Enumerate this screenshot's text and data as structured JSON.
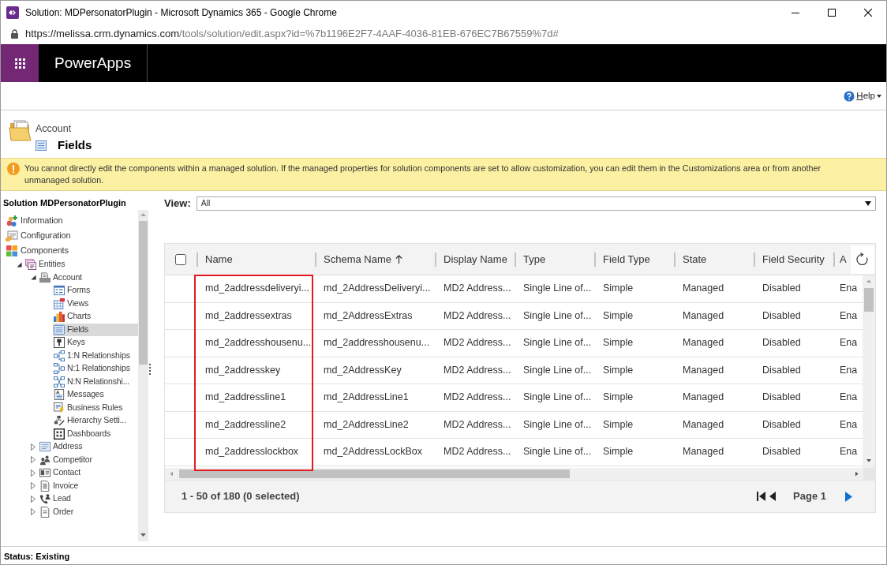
{
  "window": {
    "title": "Solution: MDPersonatorPlugin - Microsoft Dynamics 365 - Google Chrome"
  },
  "address_bar": {
    "host": "https://melissa.crm.dynamics.com",
    "path": "/tools/solution/edit.aspx?id=%7b1196E2F7-4AAF-4036-81EB-676EC7B67559%7d#"
  },
  "app_bar": {
    "title": "PowerApps"
  },
  "help": {
    "label": "Help"
  },
  "header": {
    "entity": "Account",
    "title": "Fields"
  },
  "notice": {
    "text": "You cannot directly edit the components within a managed solution. If the managed properties for solution components are set to allow customization, you can edit them in the Customizations area or from another unmanaged solution."
  },
  "sidebar": {
    "title": "Solution MDPersonatorPlugin",
    "items": [
      {
        "label": "Information",
        "kind": "information",
        "selected": false
      },
      {
        "label": "Configuration",
        "kind": "configuration",
        "selected": false
      },
      {
        "label": "Components",
        "kind": "components",
        "selected": false,
        "children": [
          {
            "label": "Entities",
            "kind": "entities",
            "selected": false,
            "expanded": true,
            "children": [
              {
                "label": "Account",
                "kind": "entity",
                "selected": false,
                "expanded": true,
                "children": [
                  {
                    "label": "Forms",
                    "kind": "forms",
                    "selected": false
                  },
                  {
                    "label": "Views",
                    "kind": "views",
                    "selected": false
                  },
                  {
                    "label": "Charts",
                    "kind": "charts",
                    "selected": false
                  },
                  {
                    "label": "Fields",
                    "kind": "fields",
                    "selected": true
                  },
                  {
                    "label": "Keys",
                    "kind": "keys",
                    "selected": false
                  },
                  {
                    "label": "1:N Relationships",
                    "kind": "relationship_1n",
                    "selected": false
                  },
                  {
                    "label": "N:1 Relationships",
                    "kind": "relationship_n1",
                    "selected": false
                  },
                  {
                    "label": "N:N Relationshi...",
                    "kind": "relationship_nn",
                    "selected": false
                  },
                  {
                    "label": "Messages",
                    "kind": "messages",
                    "selected": false
                  },
                  {
                    "label": "Business Rules",
                    "kind": "business_rules",
                    "selected": false
                  },
                  {
                    "label": "Hierarchy Setti...",
                    "kind": "hierarchy",
                    "selected": false
                  },
                  {
                    "label": "Dashboards",
                    "kind": "dashboards",
                    "selected": false
                  }
                ]
              },
              {
                "label": "Address",
                "kind": "address",
                "selected": false,
                "expanded": false
              },
              {
                "label": "Competitor",
                "kind": "competitor",
                "selected": false,
                "expanded": false
              },
              {
                "label": "Contact",
                "kind": "contact",
                "selected": false,
                "expanded": false
              },
              {
                "label": "Invoice",
                "kind": "invoice",
                "selected": false,
                "expanded": false
              },
              {
                "label": "Lead",
                "kind": "lead",
                "selected": false,
                "expanded": false
              },
              {
                "label": "Order",
                "kind": "order",
                "selected": false,
                "expanded": false
              }
            ]
          }
        ]
      }
    ]
  },
  "view": {
    "label": "View:",
    "value": "All"
  },
  "table": {
    "select_all": {
      "checked": false
    },
    "columns": [
      {
        "label": "Name",
        "highlighted": true,
        "sorted": false
      },
      {
        "label": "Schema Name",
        "highlighted": false,
        "sorted": true
      },
      {
        "label": "Display Name",
        "highlighted": false,
        "sorted": false
      },
      {
        "label": "Type",
        "highlighted": false,
        "sorted": false
      },
      {
        "label": "Field Type",
        "highlighted": false,
        "sorted": false
      },
      {
        "label": "State",
        "highlighted": false,
        "sorted": false
      },
      {
        "label": "Field Security",
        "highlighted": false,
        "sorted": false
      },
      {
        "label": "A",
        "highlighted": false,
        "sorted": false
      }
    ],
    "rows": [
      {
        "selected": false,
        "cells": [
          "md_2addressdeliveryi...",
          "md_2AddressDeliveryi...",
          "MD2 Address...",
          "Single Line of...",
          "Simple",
          "Managed",
          "Disabled",
          "Ena"
        ]
      },
      {
        "selected": false,
        "cells": [
          "md_2addressextras",
          "md_2AddressExtras",
          "MD2 Address...",
          "Single Line of...",
          "Simple",
          "Managed",
          "Disabled",
          "Ena"
        ]
      },
      {
        "selected": false,
        "cells": [
          "md_2addresshousenu...",
          "md_2addresshousenu...",
          "MD2 Address...",
          "Single Line of...",
          "Simple",
          "Managed",
          "Disabled",
          "Ena"
        ]
      },
      {
        "selected": false,
        "cells": [
          "md_2addresskey",
          "md_2AddressKey",
          "MD2 Address...",
          "Single Line of...",
          "Simple",
          "Managed",
          "Disabled",
          "Ena"
        ]
      },
      {
        "selected": false,
        "cells": [
          "md_2addressline1",
          "md_2AddressLine1",
          "MD2 Address...",
          "Single Line of...",
          "Simple",
          "Managed",
          "Disabled",
          "Ena"
        ]
      },
      {
        "selected": false,
        "cells": [
          "md_2addressline2",
          "md_2AddressLine2",
          "MD2 Address...",
          "Single Line of...",
          "Simple",
          "Managed",
          "Disabled",
          "Ena"
        ]
      },
      {
        "selected": false,
        "cells": [
          "md_2addresslockbox",
          "md_2AddressLockBox",
          "MD2 Address...",
          "Single Line of...",
          "Simple",
          "Managed",
          "Disabled",
          "Ena"
        ]
      }
    ],
    "summary": "1 - 50 of 180 (0 selected)",
    "page": "Page 1"
  },
  "status_bar": {
    "text": "Status: Existing"
  }
}
